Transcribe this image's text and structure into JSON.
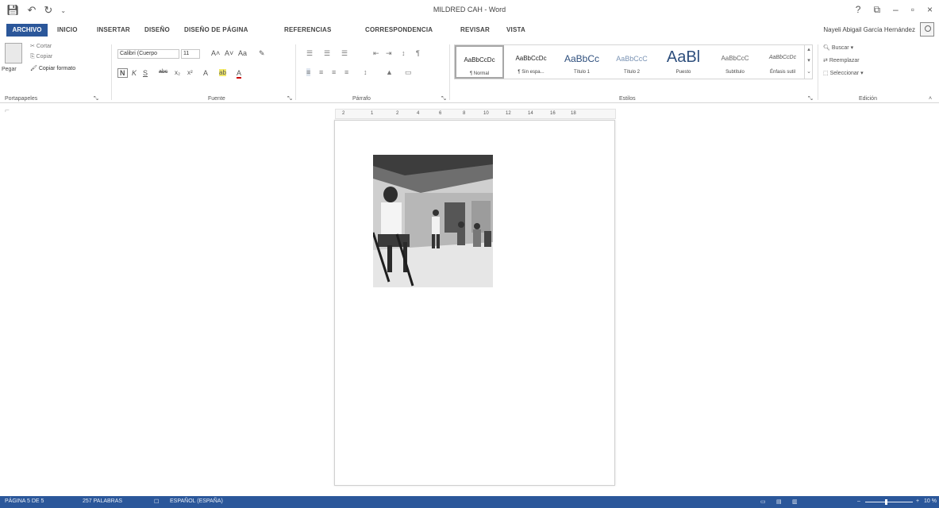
{
  "window": {
    "title": "MILDRED CAH - Word",
    "quick_access": [
      "save-icon",
      "undo-icon",
      "redo-icon",
      "customize-icon"
    ],
    "controls": {
      "help": "?",
      "ribbon_options": "⧉",
      "minimize": "–",
      "maximize": "▫",
      "close": "×"
    }
  },
  "tabs": {
    "file": "ARCHIVO",
    "items": [
      "INICIO",
      "INSERTAR",
      "DISEÑO",
      "DISEÑO DE PÁGINA",
      "REFERENCIAS",
      "CORRESPONDENCIA",
      "REVISAR",
      "VISTA"
    ],
    "user": "Nayeli Abigail García Hernández"
  },
  "clipboard": {
    "paste": "Pegar",
    "cut": "Cortar",
    "copy": "Copiar",
    "format_painter": "Copiar formato",
    "label": "Portapapeles"
  },
  "font": {
    "name": "Calibri (Cuerpo",
    "size": "11",
    "label": "Fuente",
    "buttons": {
      "grow": "A˄",
      "shrink": "A˅",
      "case": "Aa",
      "clear": "✎",
      "bold": "N",
      "italic": "K",
      "underline": "S",
      "strike": "abc",
      "subscript": "x₂",
      "superscript": "x²",
      "effects": "A",
      "highlight": "ab",
      "color": "A"
    }
  },
  "paragraph": {
    "label": "Párrafo",
    "icons": [
      "bullets-icon",
      "numbering-icon",
      "multilevel-icon",
      "decrease-indent-icon",
      "increase-indent-icon",
      "sort-icon",
      "pilcrow-icon",
      "align-left-icon",
      "center-icon",
      "align-right-icon",
      "justify-icon",
      "line-spacing-icon",
      "shading-icon",
      "borders-icon"
    ],
    "glyphs": [
      "☰",
      "☰",
      "☰",
      "⇤",
      "⇥",
      "↕",
      "¶",
      "≡",
      "≡",
      "≡",
      "≡",
      "↕",
      "▲",
      "▭"
    ]
  },
  "styles": {
    "label": "Estilos",
    "items": [
      {
        "sample": "AaBbCcDc",
        "name": "¶ Normal"
      },
      {
        "sample": "AaBbCcDc",
        "name": "¶ Sin espa..."
      },
      {
        "sample": "AaBbCc",
        "name": "Título 1"
      },
      {
        "sample": "AaBbCcC",
        "name": "Título 2"
      },
      {
        "sample": "AaBl",
        "name": "Puesto"
      },
      {
        "sample": "AaBbCcC",
        "name": "Subtítulo"
      },
      {
        "sample": "AaBbCcDc",
        "name": "Énfasis sutil"
      }
    ]
  },
  "editing": {
    "label": "Edición",
    "find": "Buscar",
    "replace": "Reemplazar",
    "select": "Seleccionar"
  },
  "ruler": {
    "numbers": [
      "2",
      "1",
      "2",
      "4",
      "6",
      "8",
      "10",
      "12",
      "14",
      "16",
      "18"
    ]
  },
  "statusbar": {
    "page": "PÁGINA 5 DE 5",
    "words": "257 PALABRAS",
    "language": "ESPAÑOL (ESPAÑA)",
    "zoom": "10 %"
  },
  "colors": {
    "accent": "#2b579a",
    "background": "#ffffff",
    "ribbon_border": "#d6d6d6"
  }
}
